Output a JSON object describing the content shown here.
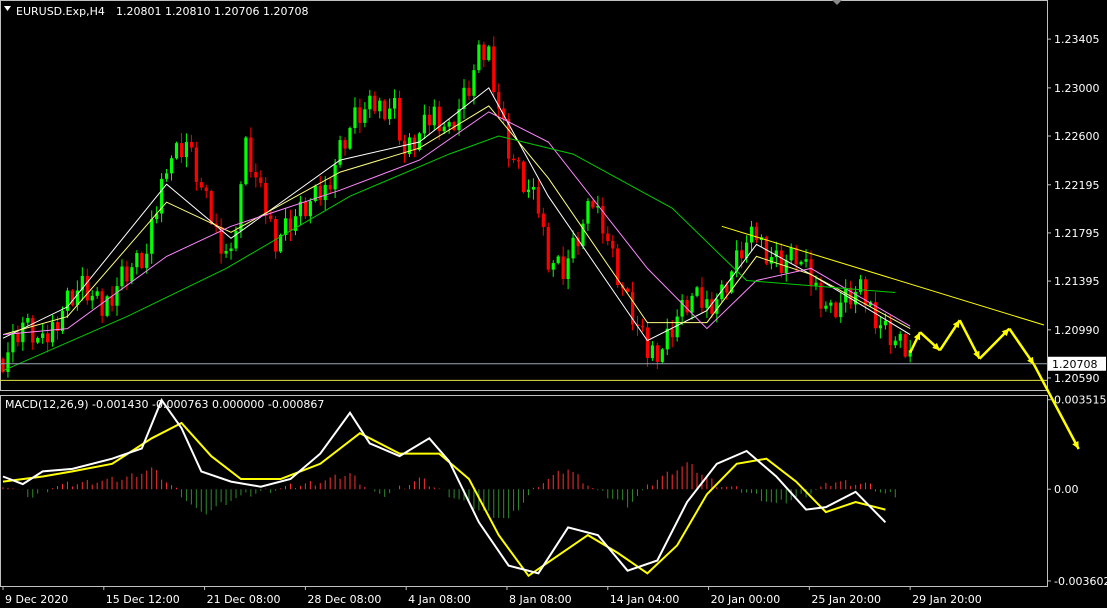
{
  "header": {
    "symbol": "EURUSD.Exp,H4",
    "ohlc": "1.20801 1.20810 1.20706 1.20708"
  },
  "macd_label": "MACD(12,26,9) -0.001430 -0.000763 0.000000 -0.000867",
  "colors": {
    "background": "#000000",
    "bull": "#00ff00",
    "bear": "#ff0000",
    "frame": "#c0c0c0",
    "ma_fast": "#ffffff",
    "ma_mid": "#ffff80",
    "ma_slow": "#ff88ff",
    "ma_long": "#00cc00",
    "trendline": "#ffff00",
    "arrows": "#ffff00",
    "macd_line": "#ffffff",
    "signal_line": "#ffff00",
    "hist_pos": "#ff3030",
    "hist_neg": "#2e8b2e"
  },
  "chart_data": [
    {
      "type": "candlestick",
      "title": "EURUSD.Exp,H4",
      "ylim": [
        1.2049,
        1.2373
      ],
      "y_ticks": [
        "1.23405",
        "1.23000",
        "1.22600",
        "1.22195",
        "1.21795",
        "1.21395",
        "1.20990",
        "1.20590"
      ],
      "current_price": "1.20708",
      "x_labels": [
        "9 Dec 2020",
        "15 Dec 12:00",
        "21 Dec 08:00",
        "28 Dec 08:00",
        "4 Jan 08:00",
        "8 Jan 08:00",
        "14 Jan 04:00",
        "20 Jan 00:00",
        "25 Jan 20:00",
        "29 Jan 20:00"
      ],
      "close_path": [
        [
          0,
          1.2075
        ],
        [
          4,
          1.2105
        ],
        [
          8,
          1.2085
        ],
        [
          13,
          1.2125
        ],
        [
          16,
          1.2135
        ],
        [
          20,
          1.2115
        ],
        [
          24,
          1.2145
        ],
        [
          29,
          1.216
        ],
        [
          33,
          1.224
        ],
        [
          37,
          1.2255
        ],
        [
          40,
          1.2215
        ],
        [
          43,
          1.218
        ],
        [
          46,
          1.216
        ],
        [
          49,
          1.225
        ],
        [
          52,
          1.221
        ],
        [
          55,
          1.2175
        ],
        [
          58,
          1.219
        ],
        [
          61,
          1.22
        ],
        [
          65,
          1.2215
        ],
        [
          68,
          1.225
        ],
        [
          71,
          1.2275
        ],
        [
          75,
          1.2285
        ],
        [
          79,
          1.2285
        ],
        [
          81,
          1.2245
        ],
        [
          84,
          1.226
        ],
        [
          87,
          1.228
        ],
        [
          90,
          1.2265
        ],
        [
          94,
          1.23
        ],
        [
          96,
          1.2325
        ],
        [
          98,
          1.233
        ],
        [
          100,
          1.2285
        ],
        [
          102,
          1.225
        ],
        [
          105,
          1.222
        ],
        [
          108,
          1.22
        ],
        [
          110,
          1.216
        ],
        [
          113,
          1.215
        ],
        [
          116,
          1.2175
        ],
        [
          119,
          1.2205
        ],
        [
          121,
          1.219
        ],
        [
          124,
          1.2145
        ],
        [
          127,
          1.211
        ],
        [
          130,
          1.208
        ],
        [
          133,
          1.2085
        ],
        [
          136,
          1.211
        ],
        [
          139,
          1.2125
        ],
        [
          142,
          1.212
        ],
        [
          145,
          1.213
        ],
        [
          149,
          1.2165
        ],
        [
          152,
          1.2178
        ],
        [
          154,
          1.2165
        ],
        [
          157,
          1.2155
        ],
        [
          160,
          1.216
        ],
        [
          163,
          1.214
        ],
        [
          167,
          1.2115
        ],
        [
          170,
          1.2125
        ],
        [
          173,
          1.213
        ],
        [
          177,
          1.2105
        ],
        [
          180,
          1.209
        ],
        [
          183,
          1.208
        ]
      ],
      "moving_averages": [
        {
          "color": "ma_fast",
          "values": [
            [
              0,
              1.2092
            ],
            [
              13,
              1.2118
            ],
            [
              33,
              1.222
            ],
            [
              46,
              1.2175
            ],
            [
              68,
              1.224
            ],
            [
              84,
              1.2255
            ],
            [
              98,
              1.23
            ],
            [
              110,
              1.221
            ],
            [
              130,
              1.209
            ],
            [
              142,
              1.2115
            ],
            [
              152,
              1.217
            ],
            [
              163,
              1.2145
            ],
            [
              183,
              1.2095
            ]
          ]
        },
        {
          "color": "ma_mid",
          "values": [
            [
              0,
              1.2095
            ],
            [
              13,
              1.211
            ],
            [
              33,
              1.2205
            ],
            [
              46,
              1.218
            ],
            [
              68,
              1.223
            ],
            [
              84,
              1.225
            ],
            [
              98,
              1.2285
            ],
            [
              110,
              1.2225
            ],
            [
              130,
              1.2105
            ],
            [
              142,
              1.2105
            ],
            [
              152,
              1.216
            ],
            [
              163,
              1.2145
            ],
            [
              183,
              1.21
            ]
          ]
        },
        {
          "color": "ma_slow",
          "values": [
            [
              0,
              1.2095
            ],
            [
              13,
              1.21
            ],
            [
              33,
              1.216
            ],
            [
              46,
              1.2185
            ],
            [
              68,
              1.2215
            ],
            [
              84,
              1.224
            ],
            [
              98,
              1.228
            ],
            [
              110,
              1.2255
            ],
            [
              130,
              1.215
            ],
            [
              142,
              1.21
            ],
            [
              152,
              1.214
            ],
            [
              163,
              1.215
            ],
            [
              183,
              1.2102
            ]
          ]
        },
        {
          "color": "ma_long",
          "values": [
            [
              0,
              1.2065
            ],
            [
              25,
              1.211
            ],
            [
              45,
              1.215
            ],
            [
              70,
              1.221
            ],
            [
              90,
              1.2245
            ],
            [
              100,
              1.226
            ],
            [
              115,
              1.2245
            ],
            [
              135,
              1.22
            ],
            [
              150,
              1.214
            ],
            [
              165,
              1.2135
            ],
            [
              180,
              1.213
            ]
          ]
        }
      ],
      "trendline": [
        [
          145,
          1.2185
        ],
        [
          210,
          1.2103
        ]
      ],
      "horizontal_lines": [
        1.20708,
        1.2057
      ],
      "projection_arrows": [
        [
          183,
          1.208
        ],
        [
          185,
          1.2097
        ],
        [
          189,
          1.2082
        ],
        [
          193,
          1.2107
        ],
        [
          197,
          1.2075
        ],
        [
          203,
          1.21
        ],
        [
          208,
          1.207
        ],
        [
          217,
          1.2
        ]
      ]
    },
    {
      "type": "macd",
      "title": "MACD(12,26,9)",
      "params": [
        12,
        26,
        9
      ],
      "values_shown": [
        "-0.001430",
        "-0.000763",
        "0.000000",
        "-0.000867"
      ],
      "ylim": [
        -0.0038,
        0.0037
      ],
      "y_ticks": [
        "0.003515",
        "0.00",
        "-0.003602"
      ],
      "macd": [
        [
          0,
          0.0005
        ],
        [
          4,
          0.0002
        ],
        [
          8,
          0.0007
        ],
        [
          14,
          0.0008
        ],
        [
          22,
          0.0012
        ],
        [
          28,
          0.0016
        ],
        [
          32,
          0.0035
        ],
        [
          36,
          0.0024
        ],
        [
          40,
          0.0007
        ],
        [
          46,
          0.0003
        ],
        [
          52,
          0.0001
        ],
        [
          58,
          0.0004
        ],
        [
          64,
          0.0014
        ],
        [
          70,
          0.003
        ],
        [
          74,
          0.0018
        ],
        [
          80,
          0.0013
        ],
        [
          86,
          0.002
        ],
        [
          90,
          0.0011
        ],
        [
          96,
          -0.0013
        ],
        [
          102,
          -0.003
        ],
        [
          108,
          -0.0033
        ],
        [
          114,
          -0.0015
        ],
        [
          120,
          -0.0018
        ],
        [
          126,
          -0.0032
        ],
        [
          132,
          -0.0028
        ],
        [
          138,
          -0.0005
        ],
        [
          144,
          0.001
        ],
        [
          150,
          0.0015
        ],
        [
          156,
          0.0005
        ],
        [
          162,
          -0.0008
        ],
        [
          166,
          -0.0007
        ],
        [
          172,
          -0.0001
        ],
        [
          178,
          -0.0013
        ]
      ],
      "signal": [
        [
          0,
          0.0003
        ],
        [
          8,
          0.0005
        ],
        [
          14,
          0.0007
        ],
        [
          22,
          0.001
        ],
        [
          30,
          0.002
        ],
        [
          36,
          0.0026
        ],
        [
          42,
          0.0013
        ],
        [
          48,
          0.0004
        ],
        [
          56,
          0.0004
        ],
        [
          64,
          0.001
        ],
        [
          72,
          0.0022
        ],
        [
          80,
          0.0014
        ],
        [
          88,
          0.0014
        ],
        [
          94,
          0.0004
        ],
        [
          100,
          -0.0018
        ],
        [
          106,
          -0.0034
        ],
        [
          112,
          -0.0026
        ],
        [
          118,
          -0.0018
        ],
        [
          124,
          -0.0025
        ],
        [
          130,
          -0.0033
        ],
        [
          136,
          -0.0022
        ],
        [
          142,
          -0.0002
        ],
        [
          148,
          0.001
        ],
        [
          154,
          0.0012
        ],
        [
          160,
          0.0003
        ],
        [
          166,
          -0.0009
        ],
        [
          172,
          -0.0005
        ],
        [
          178,
          -0.0008
        ]
      ],
      "histogram": [
        [
          0,
          0.0002
        ],
        [
          6,
          -0.0003
        ],
        [
          10,
          0.0001
        ],
        [
          18,
          0.0003
        ],
        [
          24,
          0.0004
        ],
        [
          30,
          0.0008
        ],
        [
          36,
          -0.0002
        ],
        [
          40,
          -0.001
        ],
        [
          46,
          -0.0004
        ],
        [
          52,
          -0.0001
        ],
        [
          58,
          0.0001
        ],
        [
          64,
          0.0003
        ],
        [
          70,
          0.0006
        ],
        [
          76,
          -0.0003
        ],
        [
          84,
          0.0004
        ],
        [
          90,
          -0.0002
        ],
        [
          96,
          -0.0008
        ],
        [
          102,
          -0.0012
        ],
        [
          108,
          0.0002
        ],
        [
          114,
          0.0008
        ],
        [
          120,
          -0.0001
        ],
        [
          126,
          -0.0006
        ],
        [
          132,
          0.0004
        ],
        [
          138,
          0.001
        ],
        [
          144,
          0.0002
        ],
        [
          150,
          -0.0001
        ],
        [
          156,
          -0.0006
        ],
        [
          162,
          -0.0002
        ],
        [
          168,
          0.0003
        ],
        [
          174,
          0.0002
        ],
        [
          178,
          -0.0002
        ]
      ]
    }
  ]
}
